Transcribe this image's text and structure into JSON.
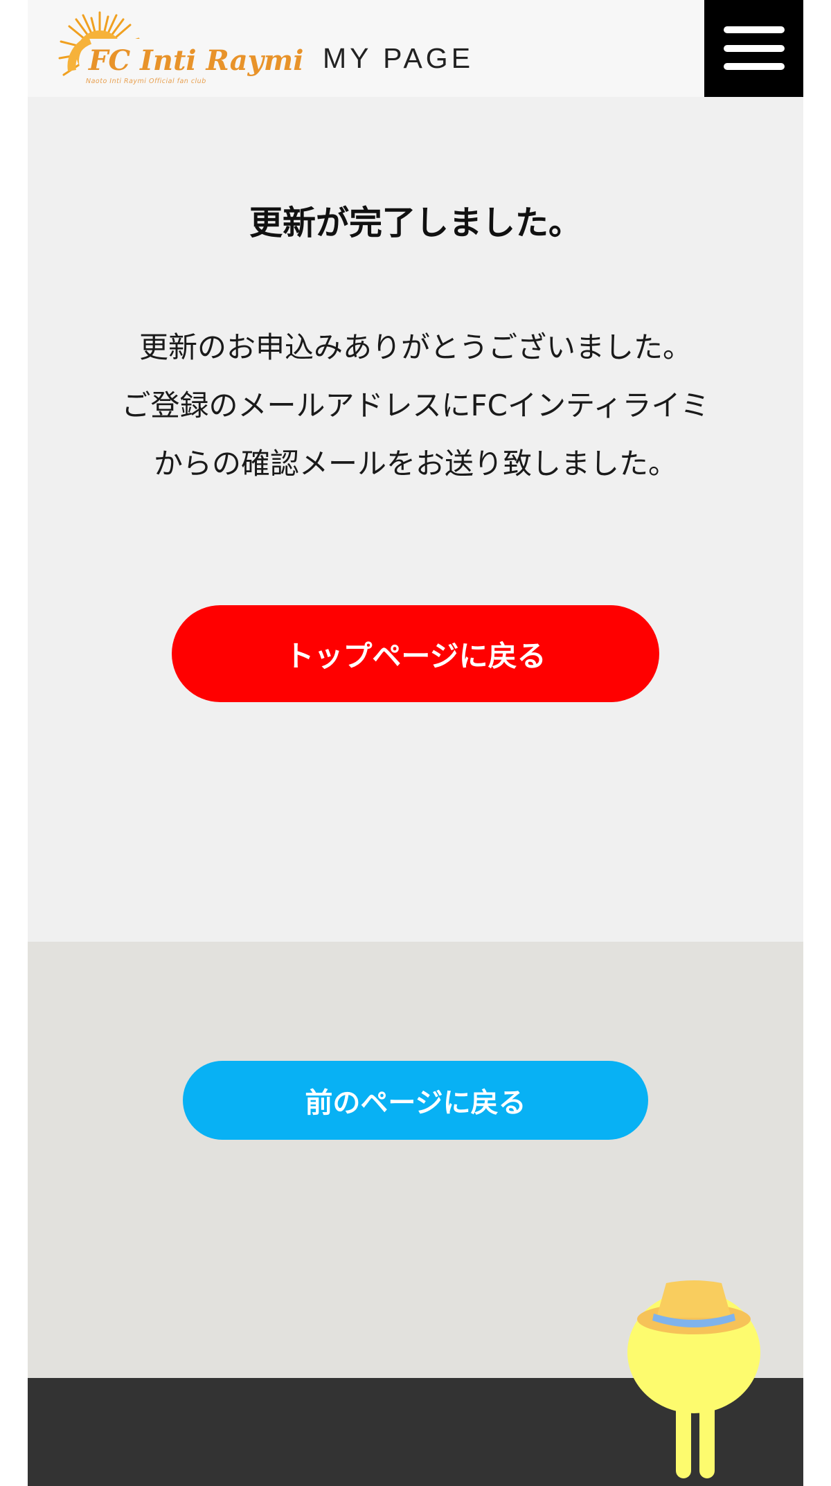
{
  "header": {
    "logo_text": "FC Inti Raymi",
    "logo_tagline": "Naoto Inti Raymi Official fan club",
    "page_label": "MY PAGE",
    "menu_icon": "hamburger-menu-icon"
  },
  "main": {
    "title": "更新が完了しました。",
    "message_lines": [
      "更新のお申込みありがとうございました。",
      "ご登録のメールアドレスにFCインティライミ",
      "からの確認メールをお送り致しました。"
    ],
    "top_button_label": "トップページに戻る"
  },
  "lower": {
    "back_button_label": "前のページに戻る"
  },
  "decor": {
    "mascot_icon": "mascot-character-icon"
  },
  "colors": {
    "header_bg": "#f7f7f7",
    "main_bg": "#f0f0f0",
    "lower_bg": "#e2e1dd",
    "footer_bg": "#333333",
    "top_button": "#ff0000",
    "back_button": "#08b1f4",
    "logo_orange": "#e8932a"
  }
}
